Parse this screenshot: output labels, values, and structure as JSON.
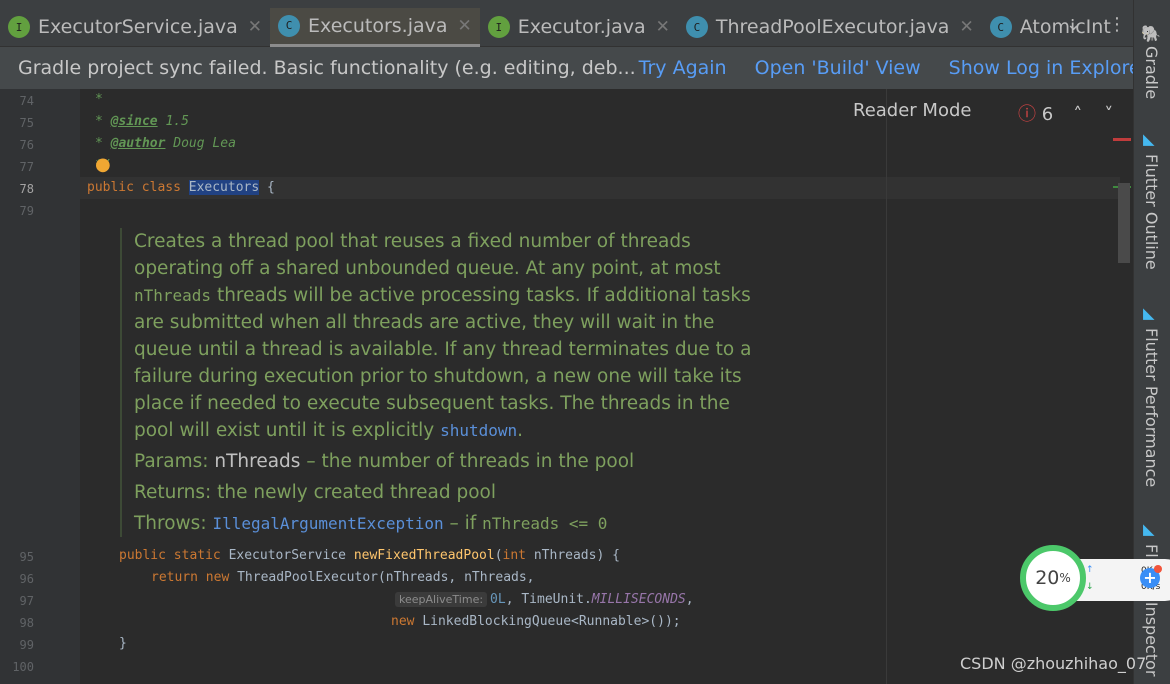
{
  "tabs": [
    {
      "label": "ExecutorService.java",
      "kind": "I"
    },
    {
      "label": "Executors.java",
      "kind": "C",
      "active": true
    },
    {
      "label": "Executor.java",
      "kind": "I"
    },
    {
      "label": "ThreadPoolExecutor.java",
      "kind": "C"
    },
    {
      "label": "AtomicInt",
      "kind": "C"
    }
  ],
  "notification": {
    "message": "Gradle project sync failed. Basic functionality (e.g. editing, deb...",
    "try_again": "Try Again",
    "open_build": "Open 'Build' View",
    "show_log": "Show Log in Explorer"
  },
  "editor_toolbar": {
    "reader_mode": "Reader Mode",
    "error_count": "6"
  },
  "lines": {
    "l74": "74",
    "l75": "75",
    "l76": "76",
    "l77": "77",
    "l78": "78",
    "l79": "79",
    "l95": "95",
    "l96": "96",
    "l97": "97",
    "l98": "98",
    "l99": "99",
    "l100": "100"
  },
  "code": {
    "c74": "*",
    "c75a": "* ",
    "c75tag": "@since",
    "c75b": " 1.5",
    "c76a": "* ",
    "c76tag": "@author",
    "c76b": " Doug Lea",
    "c77": "*/",
    "c78kw": "public class ",
    "c78cls": "Executors",
    " c78end": " {",
    "c78end": " {",
    "c95kw": "public static ",
    "c95type": "ExecutorService ",
    "c95fn": "newFixedThreadPool",
    "c95a": "(",
    "c95int": "int",
    "c95b": " nThreads) {",
    "c96kw": "return new ",
    "c96b": "ThreadPoolExecutor(nThreads, nThreads,",
    "c97hint": "keepAliveTime:",
    "c97num": "0L",
    "c97b": ", TimeUnit.",
    "c97st": "MILLISECONDS",
    "c97c": ",",
    "c98kw": "new ",
    "c98b": "LinkedBlockingQueue<Runnable>());",
    "c99": "}"
  },
  "doc": {
    "p1a": "Creates a thread pool that reuses a fixed number of threads operating off a shared unbounded queue. At any point, at most ",
    "p1code": "nThreads",
    "p1b": " threads will be active processing tasks. If additional tasks are submitted when all threads are active, they will wait in the queue until a thread is available. If any thread terminates due to a failure during execution prior to shutdown, a new one will take its place if needed to execute subsequent tasks. The threads in the pool will exist until it is explicitly ",
    "p1link": "shutdown",
    "p1c": ".",
    "params_label": "Params: ",
    "params_name": "nThreads",
    "params_desc": " – the number of threads in the pool",
    "returns_label": "Returns: ",
    "returns_desc": "the newly created thread pool",
    "throws_label": "Throws: ",
    "throws_link": "IllegalArgumentException",
    "throws_b": " – if ",
    "throws_code": "nThreads <= 0"
  },
  "right_strip": {
    "gradle": "Gradle",
    "flutter_outline": "Flutter Outline",
    "flutter_performance": "Flutter Performance",
    "flutter_inspector": "Flutter Inspector"
  },
  "overlay": {
    "percent": "20",
    "percent_sign": "%",
    "up": "0K/s",
    "down": "0K/s"
  },
  "watermark": "CSDN @zhouzhihao_07"
}
